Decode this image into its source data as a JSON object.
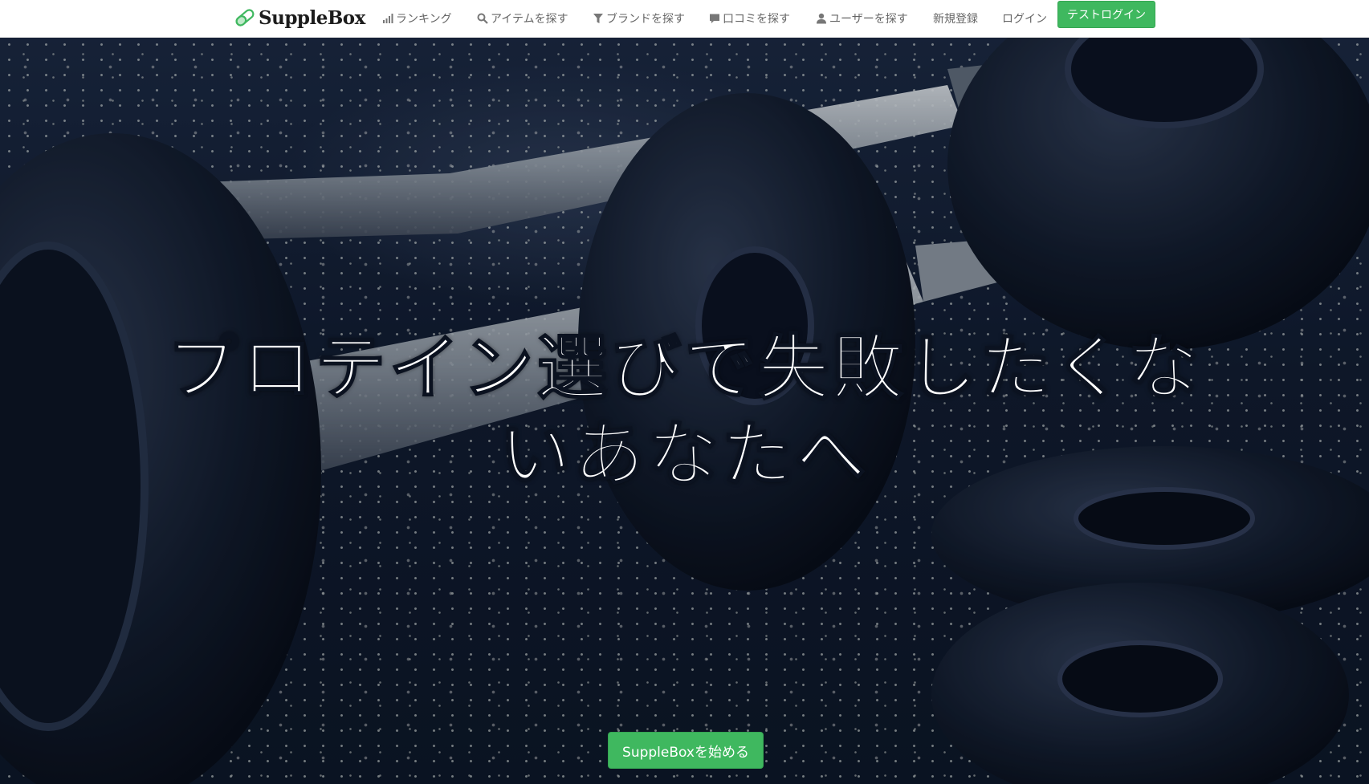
{
  "navbar": {
    "brand": {
      "name": "SuppleBox",
      "logo_icon": "capsule-icon"
    },
    "items": [
      {
        "label": "ランキング",
        "icon": "bar-chart-icon"
      },
      {
        "label": "アイテムを探す",
        "icon": "search-icon"
      },
      {
        "label": "ブランドを探す",
        "icon": "filter-icon"
      },
      {
        "label": "口コミを探す",
        "icon": "comment-icon"
      },
      {
        "label": "ユーザーを探す",
        "icon": "user-icon"
      },
      {
        "label": "新規登録"
      },
      {
        "label": "ログイン"
      }
    ],
    "test_login_label": "テストログイン"
  },
  "hero": {
    "headline_line1": "プロテイン選びで失敗したくな",
    "headline_line2": "いあなたへ",
    "cta_label": "SuppleBoxを始める"
  },
  "colors": {
    "accent_green": "#3fb85f",
    "nav_text": "#666666",
    "hero_dark": "#0b1220"
  }
}
